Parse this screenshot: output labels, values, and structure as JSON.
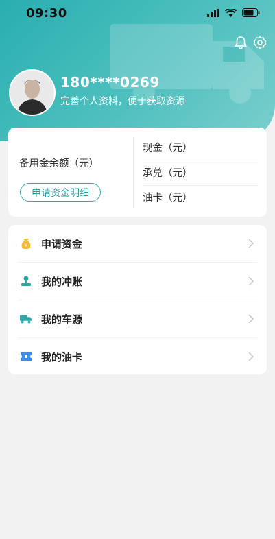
{
  "status_bar": {
    "time": "09:30"
  },
  "profile": {
    "phone": "180****0269",
    "subtitle": "完善个人资料，便于获取资源"
  },
  "balance": {
    "label": "备用金余额（元）",
    "apply_detail_button": "申请资金明细",
    "items": [
      "现金（元）",
      "承兑（元）",
      "油卡（元）"
    ]
  },
  "menu": {
    "items": [
      {
        "label": "申请资金",
        "icon": "money-bag-icon",
        "color": "#f0b93a"
      },
      {
        "label": "我的冲账",
        "icon": "stamp-icon",
        "color": "#2ea9a8"
      },
      {
        "label": "我的车源",
        "icon": "truck-icon",
        "color": "#2ea9a8"
      },
      {
        "label": "我的油卡",
        "icon": "ticket-icon",
        "color": "#3a8ee8"
      }
    ]
  },
  "colors": {
    "accent": "#2eaaa9",
    "background": "#f2f2f2"
  }
}
